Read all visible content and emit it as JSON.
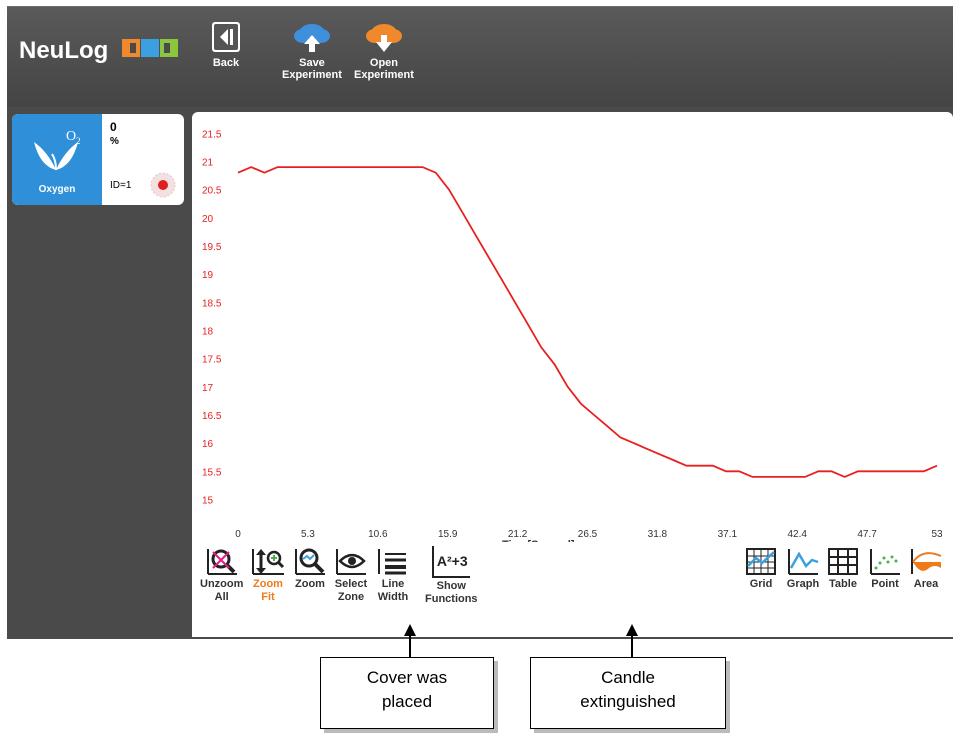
{
  "app": {
    "logo_text": "NeuLog"
  },
  "toolbar": {
    "back_label": "Back",
    "save_label_1": "Save",
    "save_label_2": "Experiment",
    "open_label_1": "Open",
    "open_label_2": "Experiment"
  },
  "sensor": {
    "name": "Oxygen",
    "value": "0",
    "unit": "%",
    "id_text": "ID=1",
    "symbol": "O",
    "symbol_sub": "2",
    "color": "#2f8fd8"
  },
  "graph_tools": {
    "unzoom_1": "Unzoom",
    "unzoom_2": "All",
    "zoomfit_1": "Zoom",
    "zoomfit_2": "Fit",
    "zoom": "Zoom",
    "select_1": "Select",
    "select_2": "Zone",
    "linewidth_1": "Line",
    "linewidth_2": "Width",
    "functions_1": "Show",
    "functions_2": "Functions",
    "functions_glyph": "A²+3",
    "grid": "Grid",
    "graph": "Graph",
    "table": "Table",
    "point": "Point",
    "area": "Area"
  },
  "annotations": {
    "cover_1": "Cover was",
    "cover_2": "placed",
    "candle_1": "Candle",
    "candle_2": "extinguished"
  },
  "chart_data": {
    "type": "line",
    "xlabel": "Time[Second]",
    "ylabel": "",
    "x_ticks": [
      "0",
      "5.3",
      "10.6",
      "15.9",
      "21.2",
      "26.5",
      "31.8",
      "37.1",
      "42.4",
      "47.7",
      "53"
    ],
    "y_ticks": [
      "21.5",
      "21",
      "20.5",
      "20",
      "19.5",
      "19",
      "18.5",
      "18",
      "17.5",
      "17",
      "16.5",
      "16",
      "15.5",
      "15"
    ],
    "xlim": [
      0,
      53
    ],
    "ylim": [
      14.6,
      21.7
    ],
    "line_color": "#e82020",
    "tick_color": "#e82020",
    "series": [
      {
        "x": [
          0,
          1,
          2,
          3,
          5,
          8,
          10,
          12,
          14,
          15,
          16,
          17,
          18,
          19,
          20,
          21,
          22,
          23,
          24,
          25,
          26,
          27,
          28,
          29,
          30,
          31,
          32,
          33,
          34,
          35,
          36,
          37,
          38,
          39,
          40,
          41,
          42,
          43,
          44,
          45,
          46,
          47,
          48,
          50,
          52,
          53
        ],
        "y": [
          20.8,
          20.9,
          20.8,
          20.9,
          20.9,
          20.9,
          20.9,
          20.9,
          20.9,
          20.8,
          20.5,
          20.1,
          19.7,
          19.3,
          18.9,
          18.5,
          18.1,
          17.7,
          17.4,
          17.0,
          16.7,
          16.5,
          16.3,
          16.1,
          16.0,
          15.9,
          15.8,
          15.7,
          15.6,
          15.6,
          15.6,
          15.5,
          15.5,
          15.4,
          15.4,
          15.4,
          15.4,
          15.4,
          15.5,
          15.5,
          15.4,
          15.5,
          15.5,
          15.5,
          15.5,
          15.6
        ]
      }
    ]
  }
}
